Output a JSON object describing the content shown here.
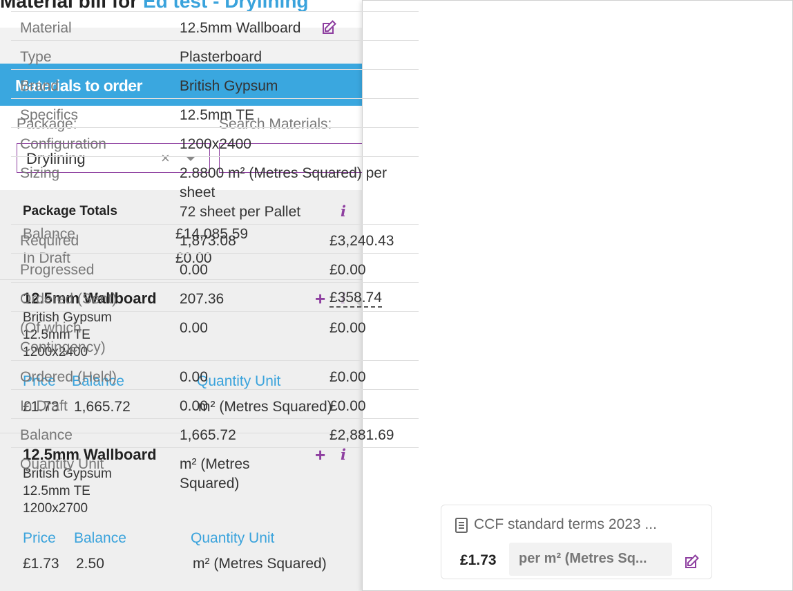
{
  "page": {
    "title_prefix": "Material bill for",
    "title_project": "Ed test",
    "title_sep": " - ",
    "title_package": "Drylining"
  },
  "panel": {
    "header": "Materials to order",
    "package_label": "Package:",
    "package_value": "Drylining",
    "clear_glyph": "×",
    "search_label": "Search Materials:",
    "search_value": ""
  },
  "totals": {
    "title": "Package Totals",
    "balance_label": "Balance",
    "balance_value": "£14,085.59",
    "draft_label": "In Draft",
    "draft_value": "£0.00"
  },
  "materials": [
    {
      "name": "12.5mm Wallboard",
      "brand": "British Gypsum",
      "spec": "12.5mm TE",
      "config": "1200x2400",
      "price_label": "Price",
      "balance_label": "Balance",
      "unit_label": "Quantity Unit",
      "price": "£1.73",
      "balance": "1,665.72",
      "unit": "m² (Metres Squared)"
    },
    {
      "name": "12.5mm Wallboard",
      "brand": "British Gypsum",
      "spec": "12.5mm TE",
      "config": "1200x2700",
      "price_label": "Price",
      "balance_label": "Balance",
      "unit_label": "Quantity Unit",
      "price": "£1.73",
      "balance": "2.50",
      "unit": "m² (Metres Squared)"
    }
  ],
  "detail": {
    "rows": [
      {
        "label": "Material",
        "v1": "12.5mm Wallboard",
        "v2": ""
      },
      {
        "label": "Type",
        "v1": "Plasterboard",
        "v2": ""
      },
      {
        "label": "Brand",
        "v1": "British Gypsum",
        "v2": ""
      },
      {
        "label": "Specifics",
        "v1": "12.5mm TE",
        "v2": ""
      },
      {
        "label": "Configuration",
        "v1": "1200x2400",
        "v2": ""
      },
      {
        "label": "Sizing",
        "v1": "2.8800 m² (Metres Squared) per sheet",
        "v1b": "72 sheet per Pallet",
        "v2": ""
      },
      {
        "label": "Required",
        "v1": "1,873.08",
        "v2": "£3,240.43"
      },
      {
        "label": "Progressed",
        "v1": "0.00",
        "v2": "£0.00"
      },
      {
        "label": "Ordered (Sent)",
        "v1": "207.36",
        "v2": "£358.74"
      },
      {
        "label": "(Of which Contingency)",
        "v1": "0.00",
        "v2": "£0.00"
      },
      {
        "label": "Ordered (Held)",
        "v1": "0.00",
        "v2": "£0.00"
      },
      {
        "label": "In Draft",
        "v1": "0.00",
        "v2": "£0.00"
      },
      {
        "label": "Balance",
        "v1": "1,665.72",
        "v2": "£2,881.69"
      },
      {
        "label": "Quantity Unit",
        "v1": "m² (Metres Squared)",
        "v2": ""
      }
    ],
    "terms": "CCF standard terms 2023 ...",
    "price": "£1.73",
    "price_unit": "per m² (Metres Sq..."
  },
  "icons": {
    "info": "i",
    "plus": "+"
  },
  "colors": {
    "brand_purple": "#8e3fa0",
    "header_blue": "#3aa7df",
    "link_blue": "#3aa3dc"
  }
}
